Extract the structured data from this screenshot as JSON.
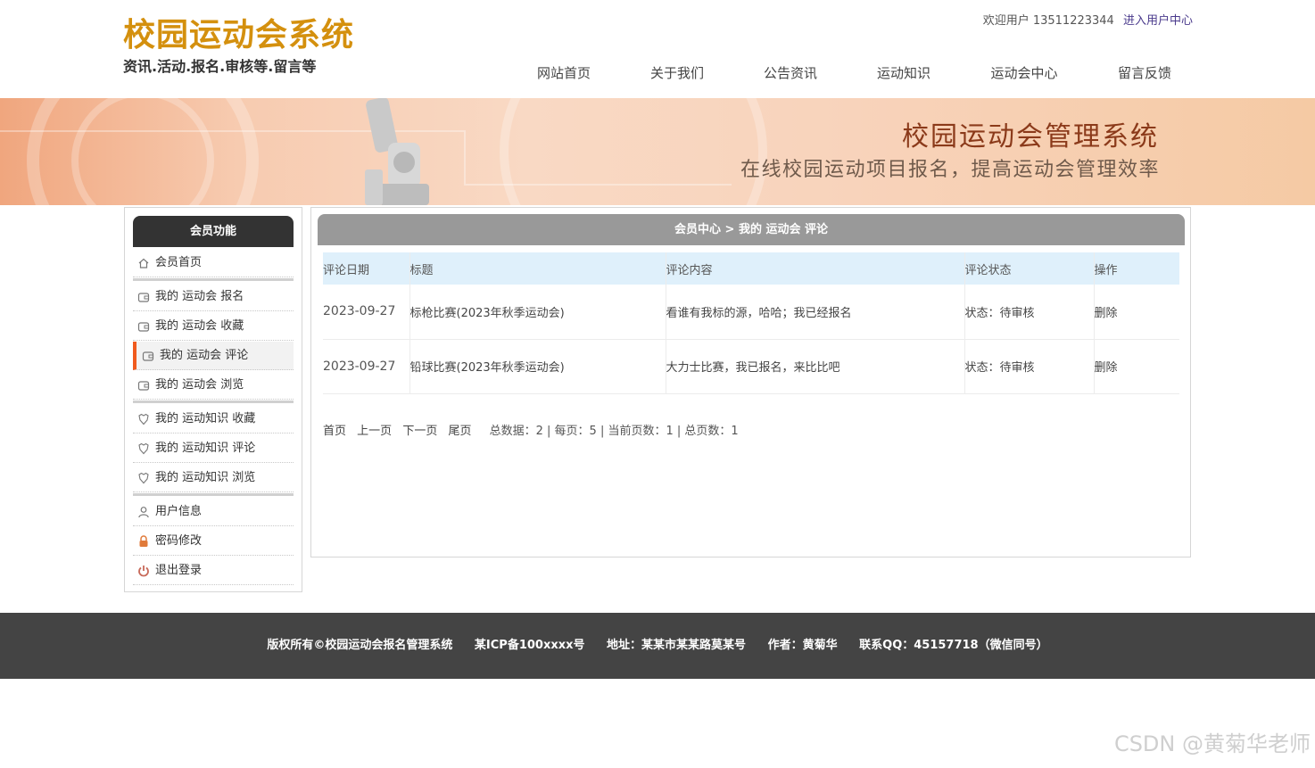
{
  "header": {
    "logo_title": "校园运动会系统",
    "logo_subtitle": "资讯.活动.报名.审核等.留言等",
    "welcome_text": "欢迎用户 13511223344",
    "user_center_link": "进入用户中心",
    "nav": [
      {
        "label": "网站首页"
      },
      {
        "label": "关于我们"
      },
      {
        "label": "公告资讯"
      },
      {
        "label": "运动知识"
      },
      {
        "label": "运动会中心"
      },
      {
        "label": "留言反馈"
      }
    ]
  },
  "banner": {
    "title": "校园运动会管理系统",
    "subtitle": "在线校园运动项目报名，提高运动会管理效率"
  },
  "sidebar": {
    "heading": "会员功能",
    "items": [
      {
        "label": "会员首页",
        "icon": "home-icon"
      },
      {
        "label": "我的 运动会 报名",
        "icon": "wallet-icon"
      },
      {
        "label": "我的 运动会 收藏",
        "icon": "wallet-icon"
      },
      {
        "label": "我的 运动会 评论",
        "icon": "wallet-icon"
      },
      {
        "label": "我的 运动会 浏览",
        "icon": "wallet-icon"
      },
      {
        "label": "我的 运动知识 收藏",
        "icon": "badge-icon"
      },
      {
        "label": "我的 运动知识 评论",
        "icon": "badge-icon"
      },
      {
        "label": "我的 运动知识 浏览",
        "icon": "badge-icon"
      },
      {
        "label": "用户信息",
        "icon": "user-icon"
      },
      {
        "label": "密码修改",
        "icon": "lock-icon"
      },
      {
        "label": "退出登录",
        "icon": "power-icon"
      }
    ],
    "active_index": 3
  },
  "main": {
    "breadcrumb": "会员中心 > 我的 运动会 评论",
    "columns": [
      "评论日期",
      "标题",
      "评论内容",
      "评论状态",
      "操作"
    ],
    "rows": [
      {
        "date": "2023-09-27",
        "title": "标枪比赛(2023年秋季运动会)",
        "content": "看谁有我标的源，哈哈；我已经报名",
        "status": "状态：待审核",
        "action": "删除"
      },
      {
        "date": "2023-09-27",
        "title": "铅球比赛(2023年秋季运动会)",
        "content": "大力士比赛，我已报名，来比比吧",
        "status": "状态：待审核",
        "action": "删除"
      }
    ],
    "pager": {
      "first": "首页",
      "prev": "上一页",
      "next": "下一页",
      "last": "尾页",
      "stats": "总数据：2 | 每页：5 | 当前页数：1 | 总页数：1"
    }
  },
  "footer": {
    "copyright": "版权所有©校园运动会报名管理系统",
    "icp": "某ICP备100xxxx号",
    "address": "地址：某某市某某路莫某号",
    "author": "作者：黄菊华",
    "contact": "联系QQ：45157718（微信同号）"
  },
  "watermark": "CSDN @黄菊华老师",
  "colors": {
    "logo": "#d4900e",
    "sidebar_head": "#333333",
    "active_marker": "#f05a1e",
    "table_head_bg": "#dff0fb",
    "footer_bg": "#444444",
    "banner_title": "#8b3a1a"
  }
}
